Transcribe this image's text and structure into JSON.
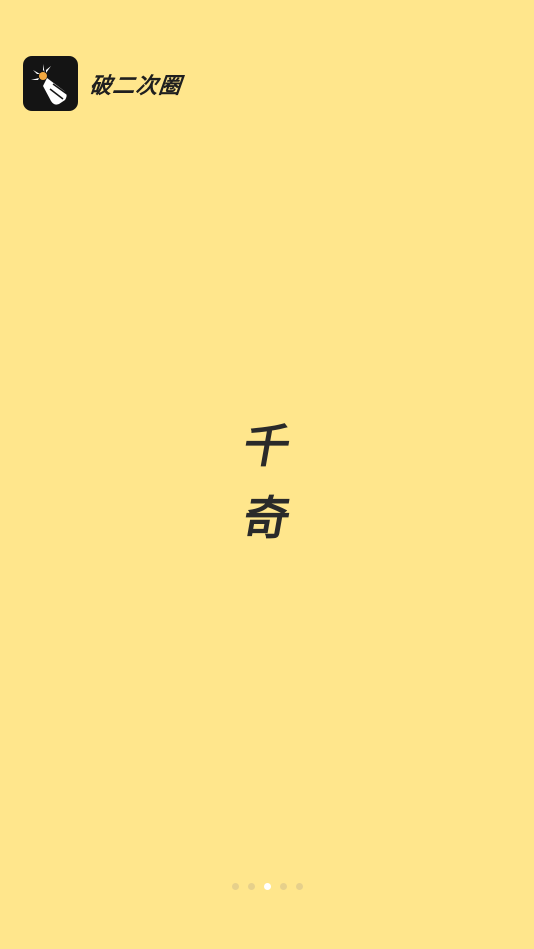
{
  "app": {
    "name": "破二次圈",
    "icon": "sparkle-hand-icon"
  },
  "center": {
    "line1": "千",
    "line2": "奇"
  },
  "pager": {
    "total": 5,
    "active_index": 2
  },
  "colors": {
    "background": "#FFE68C",
    "icon_bg": "#141414",
    "text": "#2a2a2a",
    "dot_inactive": "#E6D08B",
    "dot_active": "#FFFFFF"
  }
}
